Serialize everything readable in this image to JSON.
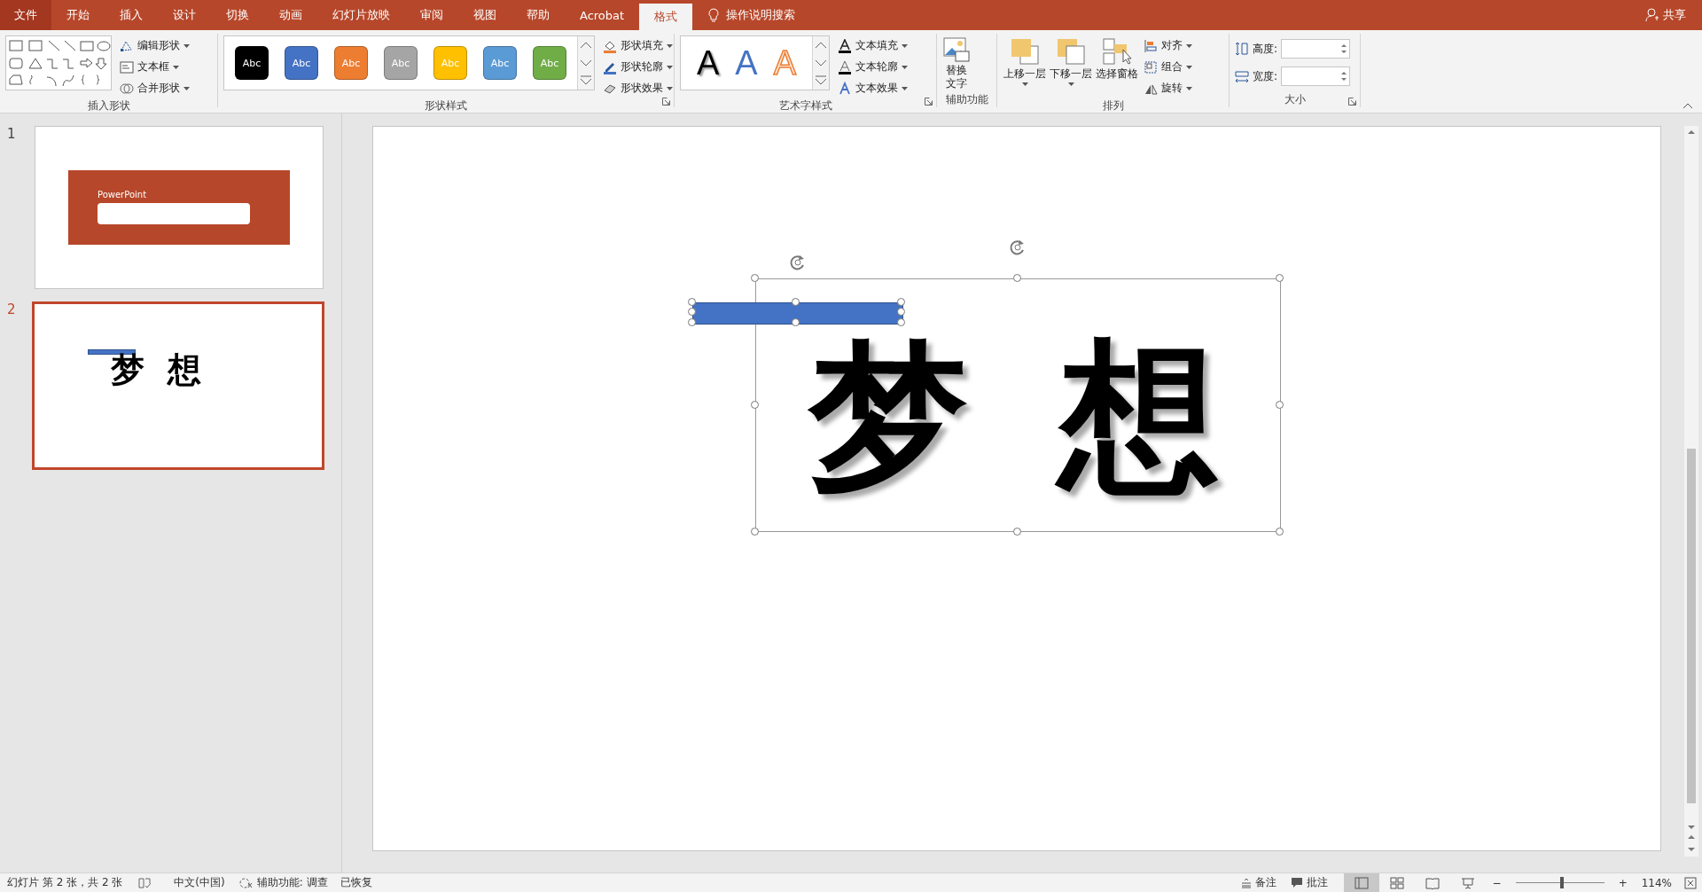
{
  "tabs": [
    {
      "label": "文件",
      "kind": "file",
      "selected": false
    },
    {
      "label": "开始",
      "kind": "tab",
      "selected": false
    },
    {
      "label": "插入",
      "kind": "tab",
      "selected": false
    },
    {
      "label": "设计",
      "kind": "tab",
      "selected": false
    },
    {
      "label": "切换",
      "kind": "tab",
      "selected": false
    },
    {
      "label": "动画",
      "kind": "tab",
      "selected": false
    },
    {
      "label": "幻灯片放映",
      "kind": "tab",
      "selected": false
    },
    {
      "label": "审阅",
      "kind": "tab",
      "selected": false
    },
    {
      "label": "视图",
      "kind": "tab",
      "selected": false
    },
    {
      "label": "帮助",
      "kind": "tab",
      "selected": false
    },
    {
      "label": "Acrobat",
      "kind": "tab",
      "selected": false
    },
    {
      "label": "格式",
      "kind": "tab",
      "selected": true
    }
  ],
  "tell_me": "操作说明搜索",
  "share": "共享",
  "insert_shapes": {
    "label": "插入形状",
    "commands": [
      "编辑形状",
      "文本框",
      "合并形状"
    ]
  },
  "shape_styles": {
    "label": "形状样式",
    "swatches": [
      {
        "text": "Abc",
        "color": "#000000"
      },
      {
        "text": "Abc",
        "color": "#4472c4"
      },
      {
        "text": "Abc",
        "color": "#ed7d31"
      },
      {
        "text": "Abc",
        "color": "#a5a5a5"
      },
      {
        "text": "Abc",
        "color": "#ffc000"
      },
      {
        "text": "Abc",
        "color": "#5b9bd5"
      },
      {
        "text": "Abc",
        "color": "#70ad47"
      }
    ],
    "commands": [
      "形状填充",
      "形状轮廓",
      "形状效果"
    ]
  },
  "wordart": {
    "label": "艺术字样式",
    "samples": [
      {
        "text": "A",
        "kind": "plain"
      },
      {
        "text": "A",
        "kind": "blue"
      },
      {
        "text": "A",
        "kind": "outline"
      }
    ],
    "commands": [
      "文本填充",
      "文本轮廓",
      "文本效果"
    ]
  },
  "accessibility": {
    "label": "辅助功能",
    "button_lines": [
      "替换",
      "文字"
    ]
  },
  "arrange": {
    "label": "排列",
    "large": [
      "上移一层",
      "下移一层",
      "选择窗格"
    ],
    "small": [
      "对齐",
      "组合",
      "旋转"
    ]
  },
  "size": {
    "label": "大小",
    "fields": [
      {
        "label": "高度:"
      },
      {
        "label": "宽度:"
      }
    ]
  },
  "slides": [
    {
      "number": "1",
      "kind": "title",
      "selected": false,
      "title": "PowerPoint"
    },
    {
      "number": "2",
      "kind": "text",
      "selected": true,
      "text": "梦 想"
    }
  ],
  "canvas": {
    "text": "梦 想"
  },
  "status_bar": {
    "slide_info": "幻灯片 第 2 张，共 2 张",
    "language": "中文(中国)",
    "accessibility": "辅助功能: 调查",
    "recovered": "已恢复",
    "notes": "备注",
    "comments": "批注",
    "views": [
      {
        "kind": "normal",
        "selected": true
      },
      {
        "kind": "sorter",
        "selected": false
      },
      {
        "kind": "reading",
        "selected": false
      },
      {
        "kind": "slideshow",
        "selected": false
      }
    ],
    "zoom": {
      "minus": "−",
      "plus": "+",
      "level": 0.52,
      "value": "114%"
    }
  }
}
